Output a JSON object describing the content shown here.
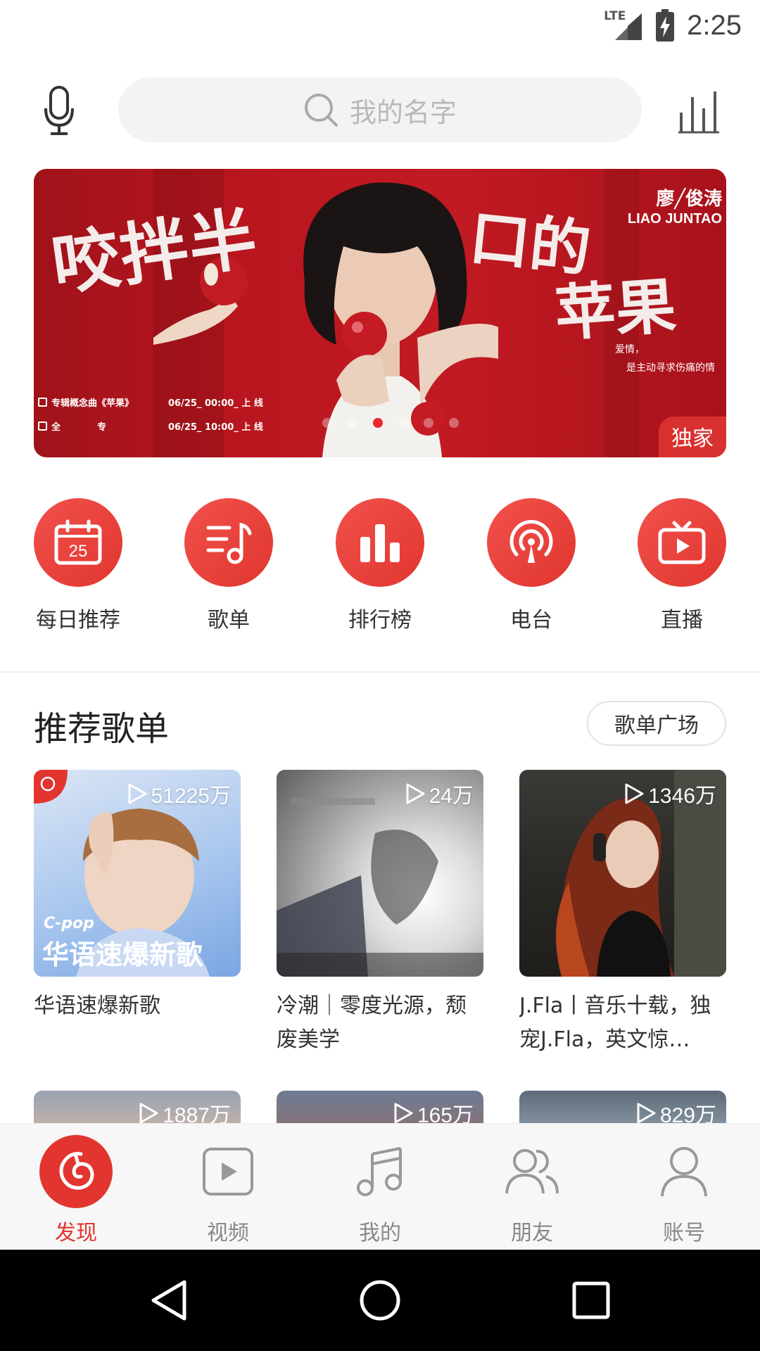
{
  "status_bar": {
    "network": "LTE",
    "time": "2:25"
  },
  "header": {
    "search_placeholder": "我的名字"
  },
  "banner": {
    "headline_left": "咬拌半",
    "headline_right_1": "口的",
    "headline_right_2": "苹果",
    "artist_cn": "廖╱俊涛",
    "artist_en": "LIAO JUNTAO",
    "quote_1": "爱情，",
    "quote_2": "是主动寻求伤痛的情",
    "info_1_label": "专辑概念曲《苹果》",
    "info_1_time": "06/25_ 00:00_ 上 线",
    "info_2_label": "全　　　　专",
    "info_2_time": "06/25_ 10:00_ 上 线",
    "badge": "独家",
    "colors": {
      "background": "#b9161f",
      "active_dot": "#e8262c",
      "badge": "#d9312f"
    }
  },
  "quick_nav": [
    {
      "label": "每日推荐",
      "icon": "calendar-icon",
      "icon_text": "25"
    },
    {
      "label": "歌单",
      "icon": "playlist-icon"
    },
    {
      "label": "排行榜",
      "icon": "chart-bars-icon"
    },
    {
      "label": "电台",
      "icon": "radio-icon"
    },
    {
      "label": "直播",
      "icon": "tv-play-icon"
    }
  ],
  "recommended": {
    "title": "推荐歌单",
    "more_button": "歌单广场",
    "playlists": [
      {
        "count": "51225万",
        "title": "华语速爆新歌",
        "cover_tag": "C-pop",
        "cover_text": "华语速爆新歌"
      },
      {
        "count": "24万",
        "title": "冷潮｜零度光源，颓废美学"
      },
      {
        "count": "1346万",
        "title": "J.Fla丨音乐十载，独宠J.Fla，英文惊…"
      },
      {
        "count": "1887万"
      },
      {
        "count": "165万"
      },
      {
        "count": "829万"
      }
    ]
  },
  "tabbar": [
    {
      "label": "发现",
      "icon": "netease-logo-icon",
      "active": true
    },
    {
      "label": "视频",
      "icon": "video-icon"
    },
    {
      "label": "我的",
      "icon": "music-note-icon"
    },
    {
      "label": "朋友",
      "icon": "friends-icon"
    },
    {
      "label": "账号",
      "icon": "account-icon"
    }
  ],
  "theme": {
    "accent": "#e2352f"
  }
}
